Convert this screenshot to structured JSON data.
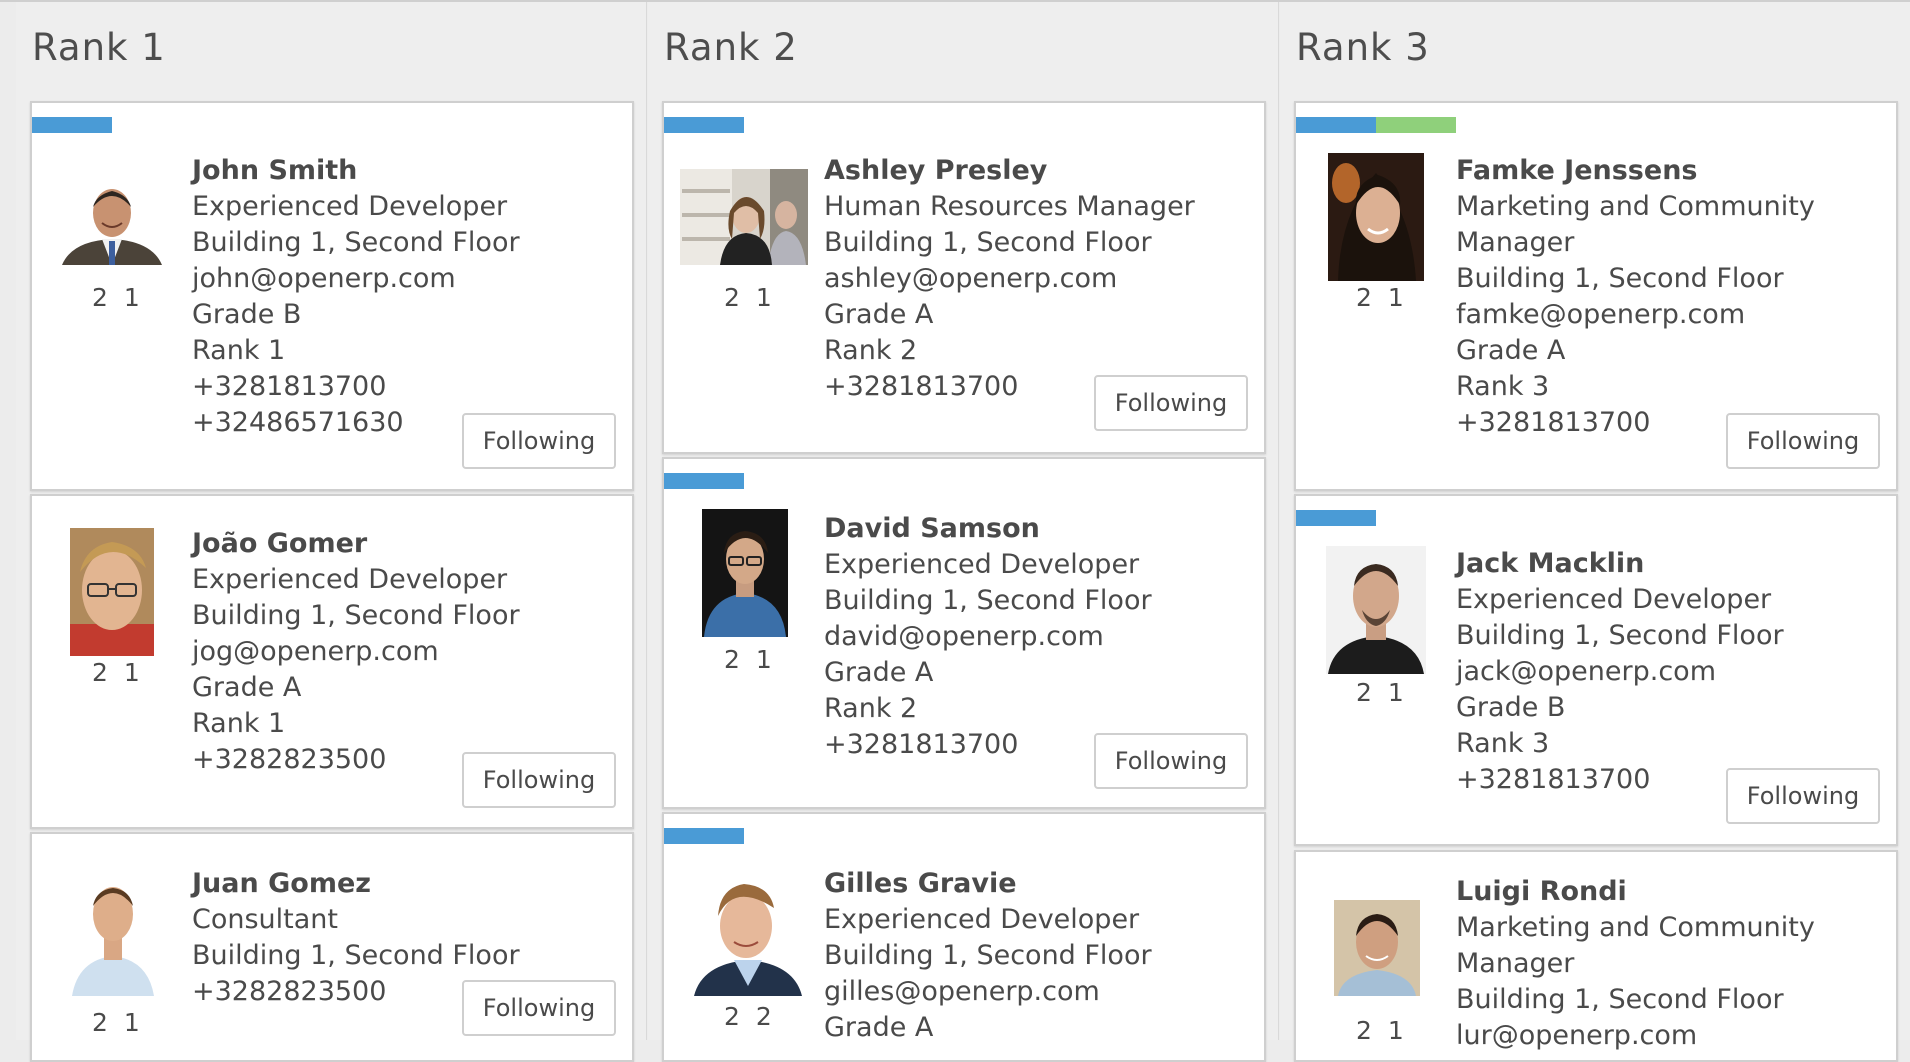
{
  "colors": {
    "tag_blue": "#4a9bd6",
    "tag_green": "#8fd07b"
  },
  "columns": [
    {
      "title": "Rank 1",
      "cards": [
        {
          "name": "John Smith",
          "lines": [
            "Experienced Developer",
            "Building 1, Second Floor",
            "john@openerp.com",
            "Grade B",
            "Rank 1",
            "+3281813700",
            "+32486571630"
          ],
          "counts": "2 1",
          "button": "Following",
          "tags": [
            "blue"
          ]
        },
        {
          "name": "João Gomer",
          "lines": [
            "Experienced Developer",
            "Building 1, Second Floor",
            "jog@openerp.com",
            "Grade A",
            "Rank 1",
            "+3282823500"
          ],
          "counts": "2 1",
          "button": "Following",
          "tags": []
        },
        {
          "name": "Juan Gomez",
          "lines": [
            "Consultant",
            "Building 1, Second Floor",
            "+3282823500"
          ],
          "counts": "2 1",
          "button": "Following",
          "tags": []
        }
      ]
    },
    {
      "title": "Rank 2",
      "cards": [
        {
          "name": "Ashley Presley",
          "lines": [
            "Human Resources Manager",
            "Building 1, Second Floor",
            "ashley@openerp.com",
            "Grade A",
            "Rank 2",
            "+3281813700"
          ],
          "counts": "2 1",
          "button": "Following",
          "tags": [
            "blue"
          ]
        },
        {
          "name": "David Samson",
          "lines": [
            "Experienced Developer",
            "Building 1, Second Floor",
            "david@openerp.com",
            "Grade A",
            "Rank 2",
            "+3281813700"
          ],
          "counts": "2 1",
          "button": "Following",
          "tags": [
            "blue"
          ]
        },
        {
          "name": "Gilles Gravie",
          "lines": [
            "Experienced Developer",
            "Building 1, Second Floor",
            "gilles@openerp.com",
            "Grade A"
          ],
          "counts": "2 2",
          "tags": [
            "blue"
          ]
        }
      ]
    },
    {
      "title": "Rank 3",
      "cards": [
        {
          "name": "Famke Jenssens",
          "lines": [
            "Marketing and Community",
            "Manager",
            "Building 1, Second Floor",
            "famke@openerp.com",
            "Grade A",
            "Rank 3",
            "+3281813700"
          ],
          "counts": "2 1",
          "button": "Following",
          "tags": [
            "blue",
            "green"
          ]
        },
        {
          "name": "Jack Macklin",
          "lines": [
            "Experienced Developer",
            "Building 1, Second Floor",
            "jack@openerp.com",
            "Grade B",
            "Rank 3",
            "+3281813700"
          ],
          "counts": "2 1",
          "button": "Following",
          "tags": [
            "blue"
          ]
        },
        {
          "name": "Luigi Rondi",
          "lines": [
            "Marketing and Community",
            "Manager",
            "Building 1, Second Floor",
            "lur@openerp.com"
          ],
          "counts": "2 1",
          "tags": []
        }
      ]
    }
  ]
}
